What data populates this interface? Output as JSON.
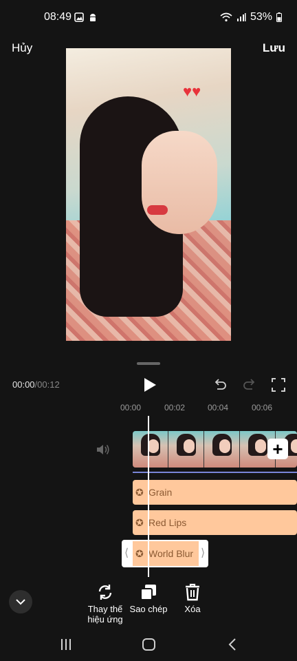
{
  "status_bar": {
    "time": "08:49",
    "battery": "53%"
  },
  "header": {
    "cancel_label": "Hủy",
    "save_label": "Lưu"
  },
  "playback": {
    "current_time": "00:00",
    "separator": "/",
    "total_time": "00:12"
  },
  "ruler": {
    "ticks": [
      "00:00",
      "00:02",
      "00:04",
      "00:06"
    ]
  },
  "effects": [
    {
      "label": "Grain"
    },
    {
      "label": "Red Lips"
    },
    {
      "label": "World Blur"
    }
  ],
  "toolbar": {
    "replace_label_line1": "Thay thế",
    "replace_label_line2": "hiệu ứng",
    "copy_label": "Sao chép",
    "delete_label": "Xóa"
  },
  "colors": {
    "background": "#141414",
    "effect_fill": "#ffc89c",
    "effect_text": "#8b5a33",
    "track_line": "#7a86d8"
  }
}
